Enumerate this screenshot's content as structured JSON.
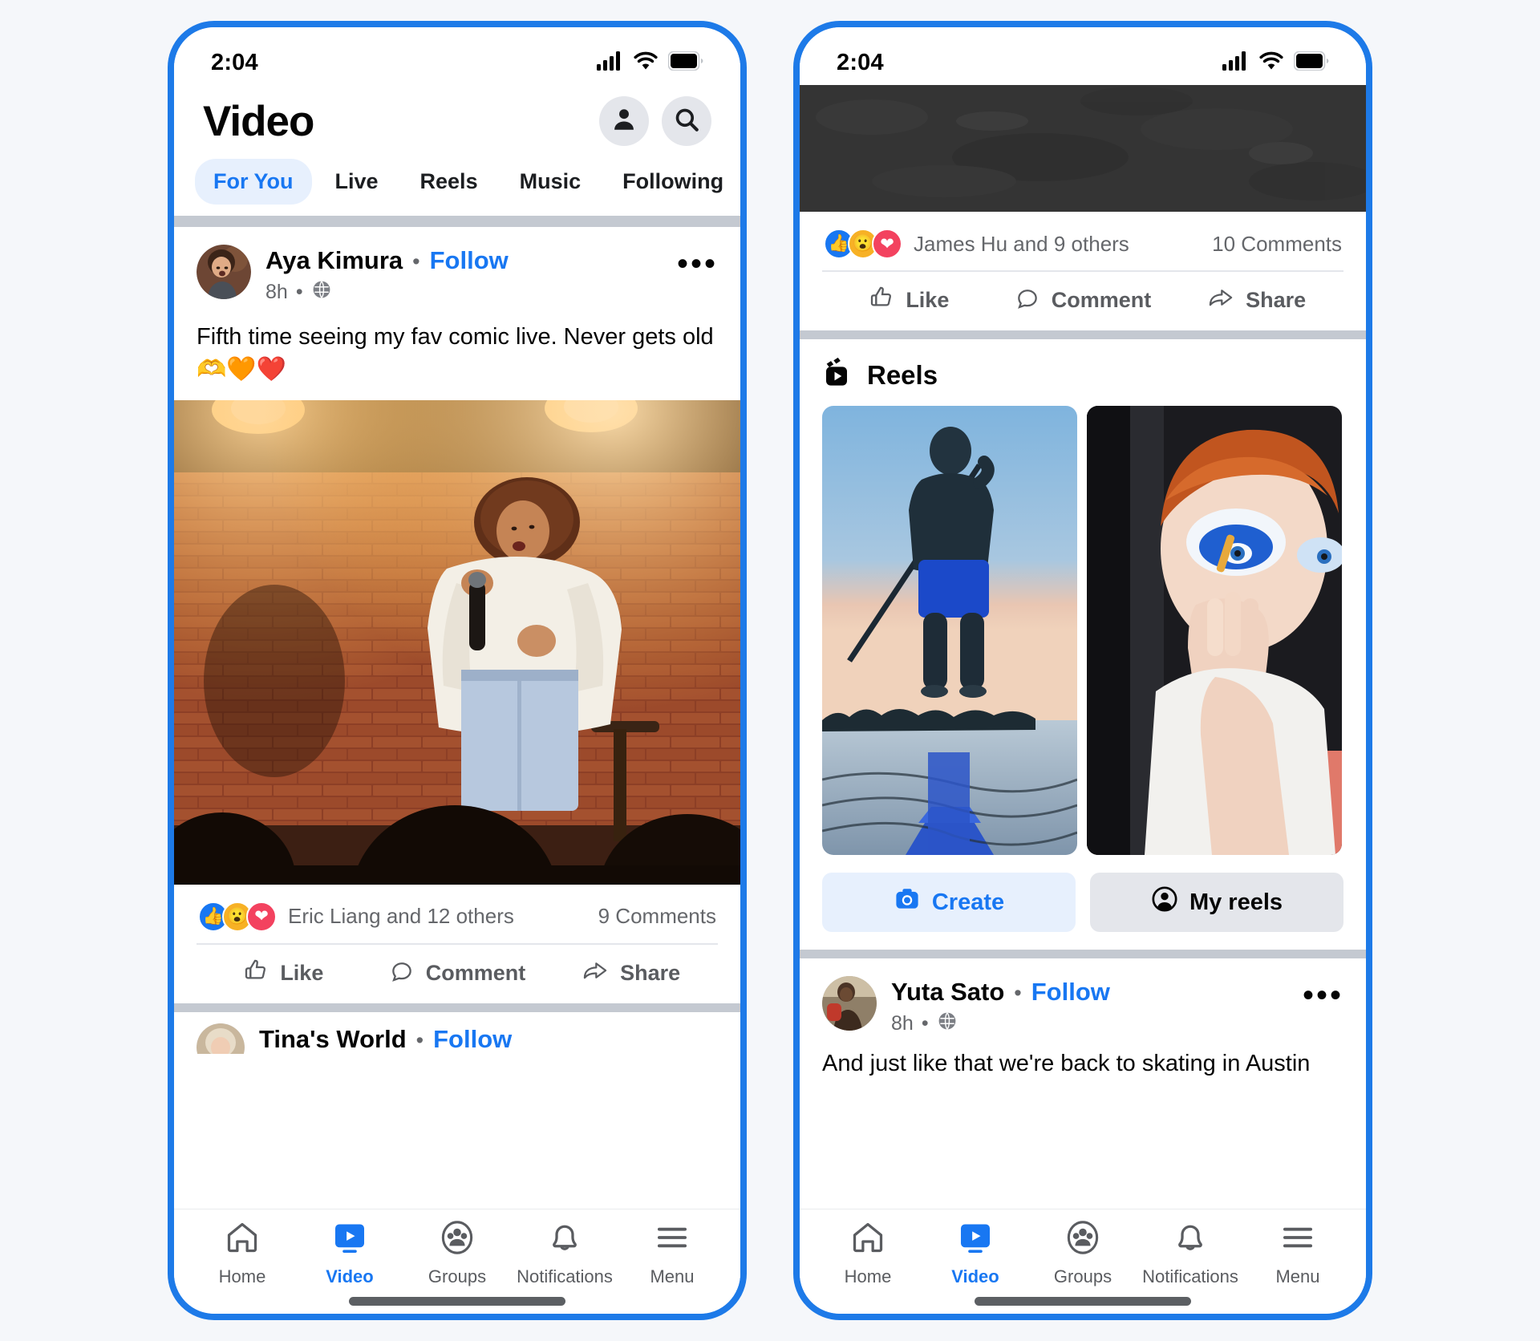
{
  "theme": {
    "brand_blue": "#1877f2",
    "frame_blue": "#1d7ae8",
    "page_bg": "#f5f7fa",
    "divider_gray": "#c4c9d1",
    "chip_bg": "#e7f0fd",
    "muted_text": "#65676b"
  },
  "left_phone": {
    "status": {
      "time": "2:04",
      "signal_icon": "cellular-signal-icon",
      "wifi_icon": "wifi-icon",
      "battery_icon": "battery-icon"
    },
    "header": {
      "title": "Video",
      "profile_icon": "profile-icon",
      "search_icon": "search-icon"
    },
    "tabs": [
      {
        "label": "For You",
        "active": true
      },
      {
        "label": "Live",
        "active": false
      },
      {
        "label": "Reels",
        "active": false
      },
      {
        "label": "Music",
        "active": false
      },
      {
        "label": "Following",
        "active": false
      }
    ],
    "post": {
      "author": "Aya Kimura",
      "separator": "•",
      "follow_label": "Follow",
      "time": "8h",
      "time_dot": "•",
      "privacy_icon": "globe-icon",
      "more_icon": "ellipsis-icon",
      "text": "Fifth time seeing my fav comic live. Never gets old",
      "emojis": "🫶🧡❤️",
      "media_alt": "standup-comedian-on-stage-brick-wall"
    },
    "reactions": {
      "icons": [
        "like-reaction-icon",
        "wow-reaction-icon",
        "love-reaction-icon"
      ],
      "names": "Eric Liang and 12 others",
      "comments": "9 Comments"
    },
    "actions": [
      {
        "label": "Like",
        "icon": "thumbs-up-icon"
      },
      {
        "label": "Comment",
        "icon": "comment-bubble-icon"
      },
      {
        "label": "Share",
        "icon": "share-arrow-icon"
      }
    ],
    "next_post_peek": {
      "author": "Tina's World",
      "separator": "•",
      "follow_label": "Follow"
    },
    "bottom_nav": [
      {
        "label": "Home",
        "icon": "home-icon",
        "active": false
      },
      {
        "label": "Video",
        "icon": "video-play-icon",
        "active": true
      },
      {
        "label": "Groups",
        "icon": "groups-icon",
        "active": false
      },
      {
        "label": "Notifications",
        "icon": "bell-icon",
        "active": false
      },
      {
        "label": "Menu",
        "icon": "hamburger-menu-icon",
        "active": false
      }
    ]
  },
  "right_phone": {
    "status": {
      "time": "2:04",
      "signal_icon": "cellular-signal-icon",
      "wifi_icon": "wifi-icon",
      "battery_icon": "battery-icon"
    },
    "top_post": {
      "media_alt": "dark-textured-video-still",
      "reactions": {
        "icons": [
          "like-reaction-icon",
          "wow-reaction-icon",
          "love-reaction-icon"
        ],
        "names": "James Hu and 9 others",
        "comments": "10 Comments"
      },
      "actions": [
        {
          "label": "Like",
          "icon": "thumbs-up-icon"
        },
        {
          "label": "Comment",
          "icon": "comment-bubble-icon"
        },
        {
          "label": "Share",
          "icon": "share-arrow-icon"
        }
      ]
    },
    "reels": {
      "section_icon": "reels-clapper-icon",
      "title": "Reels",
      "cards": [
        {
          "alt": "paddleboarder-at-dusk-blue-shorts"
        },
        {
          "alt": "person-applying-blue-eyeshadow"
        }
      ],
      "create_button": {
        "label": "Create",
        "icon": "camera-icon"
      },
      "my_reels_button": {
        "label": "My reels",
        "icon": "account-circle-icon"
      }
    },
    "bottom_post": {
      "author": "Yuta Sato",
      "separator": "•",
      "follow_label": "Follow",
      "time": "8h",
      "time_dot": "•",
      "privacy_icon": "globe-icon",
      "more_icon": "ellipsis-icon",
      "text": "And just like that we're back to skating in Austin"
    },
    "bottom_nav": [
      {
        "label": "Home",
        "icon": "home-icon",
        "active": false
      },
      {
        "label": "Video",
        "icon": "video-play-icon",
        "active": true
      },
      {
        "label": "Groups",
        "icon": "groups-icon",
        "active": false
      },
      {
        "label": "Notifications",
        "icon": "bell-icon",
        "active": false
      },
      {
        "label": "Menu",
        "icon": "hamburger-menu-icon",
        "active": false
      }
    ]
  }
}
